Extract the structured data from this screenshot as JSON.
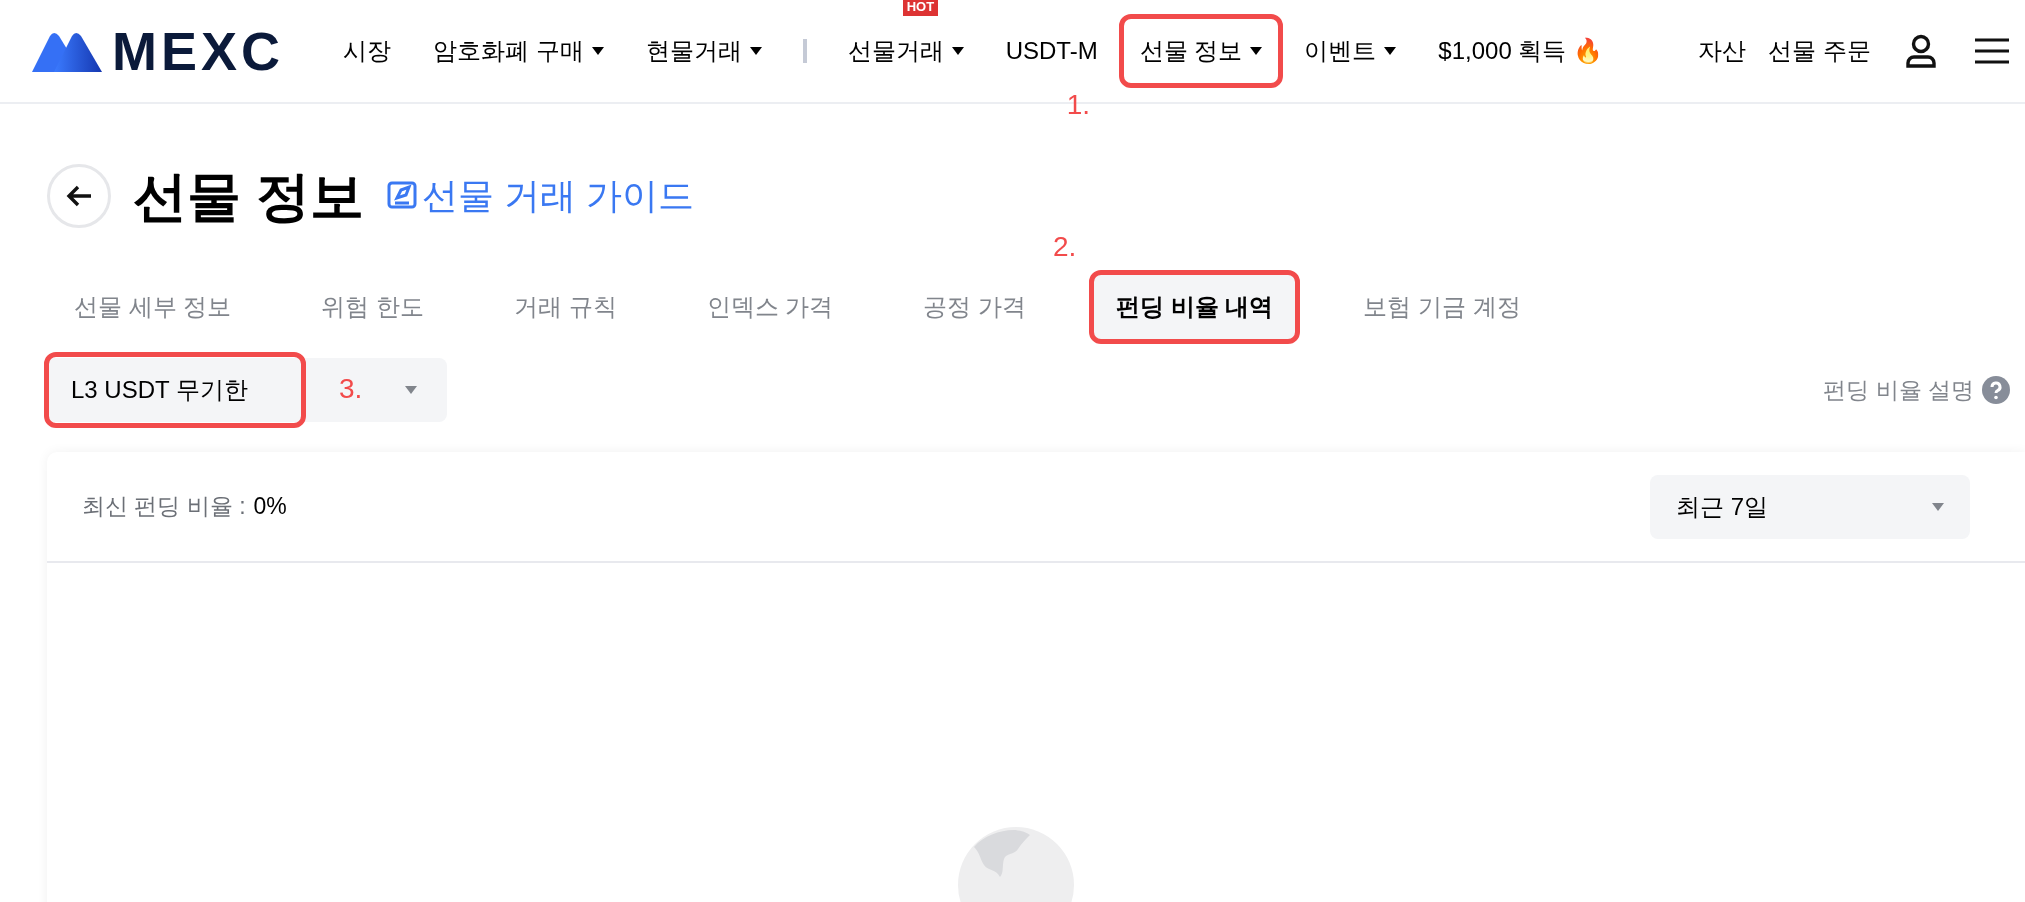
{
  "header": {
    "logo": "MEXC",
    "nav": [
      {
        "label": "시장",
        "dropdown": false,
        "highlighted": false
      },
      {
        "label": "암호화폐 구매",
        "dropdown": true,
        "highlighted": false
      },
      {
        "label": "현물거래",
        "dropdown": true,
        "highlighted": false,
        "divider_after": true
      },
      {
        "label": "선물거래",
        "dropdown": true,
        "highlighted": false,
        "badge": "HOT"
      },
      {
        "label": "USDT-M",
        "dropdown": false,
        "highlighted": false
      },
      {
        "label": "선물 정보",
        "dropdown": true,
        "highlighted": true,
        "annotation": "1."
      },
      {
        "label": "이벤트",
        "dropdown": true,
        "highlighted": false
      },
      {
        "label": "$1,000 획득 🔥",
        "dropdown": false,
        "highlighted": false
      }
    ],
    "right_links": [
      "자산",
      "선물 주문"
    ]
  },
  "page": {
    "title": "선물 정보",
    "guide_link": "선물 거래 가이드",
    "tabs": [
      {
        "label": "선물 세부 정보",
        "selected": false,
        "highlighted": false
      },
      {
        "label": "위험 한도",
        "selected": false,
        "highlighted": false
      },
      {
        "label": "거래 규칙",
        "selected": false,
        "highlighted": false
      },
      {
        "label": "인덱스 가격",
        "selected": false,
        "highlighted": false
      },
      {
        "label": "공정 가격",
        "selected": false,
        "highlighted": false
      },
      {
        "label": "펀딩 비율 내역",
        "selected": true,
        "highlighted": true,
        "annotation": "2."
      },
      {
        "label": "보험 기금 계정",
        "selected": false,
        "highlighted": false
      }
    ],
    "contract_select": {
      "value": "L3 USDT 무기한",
      "highlighted": true,
      "annotation": "3."
    },
    "help_link": "펀딩 비율 설명",
    "card": {
      "rate_label": "최신 펀딩 비율 :",
      "rate_value": "0%",
      "period_select": "최근 7일"
    }
  }
}
